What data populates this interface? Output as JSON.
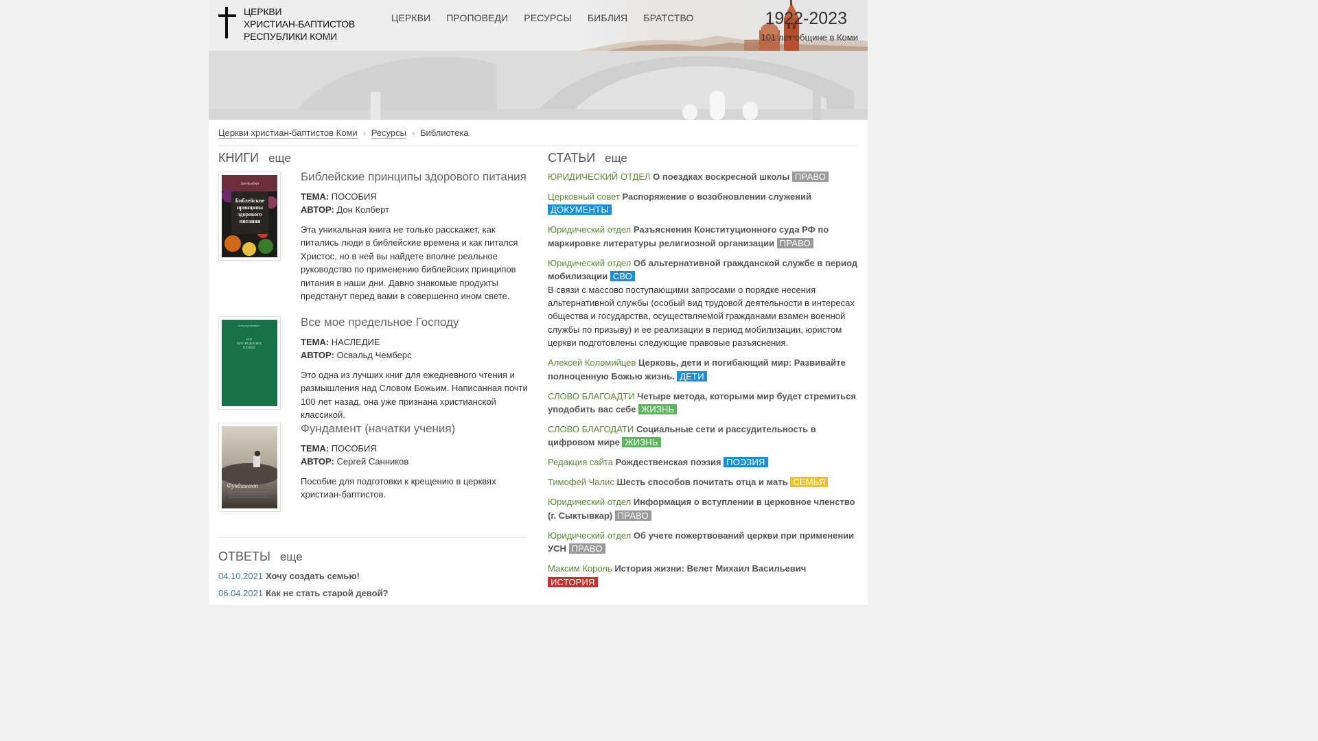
{
  "header": {
    "logo_lines": [
      "ЦЕРКВИ",
      "ХРИСТИАН-БАПТИСТОВ",
      "РЕСПУБЛИКИ КОМИ"
    ],
    "nav": [
      "ЦЕРКВИ",
      "ПРОПОВЕДИ",
      "РЕСУРСЫ",
      "БИБЛИЯ",
      "БРАТСТВО"
    ],
    "years": "1922-2023",
    "years_sub": "101 лет общине в Коми"
  },
  "breadcrumb": [
    "Церкви христиан-баптистов Коми",
    "Ресурсы",
    "Библиотека"
  ],
  "books": {
    "title": "КНИГИ",
    "more": "еще",
    "items": [
      {
        "title": "Библейские принципы здорового питания",
        "topic_label": "ТЕМА:",
        "topic": "ПОСОБИЯ",
        "author_label": "АВТОР:",
        "author": "Дон Колберт",
        "description": "Эта уникальная книга не только расскажет, как питались люди в библейские времена и как питался Христос, но в ней вы найдете вполне реальное руководство по применению библейских принципов питания в наши дни. Давно знакомые продукты предстанут перед вами в совершенно ином свете.",
        "cover_text": "Библейские принципы здорового питания",
        "cover_author": "Дон Колберт"
      },
      {
        "title": "Все мое предельное Господу",
        "topic_label": "ТЕМА:",
        "topic": "НАСЛЕДИЕ",
        "author_label": "АВТОР:",
        "author": "Освальд Чемберс",
        "description": "Это одна из лучших книг для ежедневного чтения и размышления над Словом Божьим. Написанная почти 100 лет назад, она уже признана христианской классикой.",
        "cover_text": "ВСЕ МОЕ ПРЕДЕЛЬНОЕ ГОСПОДУ"
      },
      {
        "title": "Фундамент (начатки учения)",
        "topic_label": "ТЕМА:",
        "topic": "ПОСОБИЯ",
        "author_label": "АВТОР:",
        "author": "Сергей Санников",
        "description": "Пособие для подготовки к крещению в церквях христиан-баптистов.",
        "cover_text": "Фундамент"
      }
    ]
  },
  "answers": {
    "title": "ОТВЕТЫ",
    "more": "еще",
    "items": [
      {
        "date": "04.10.2021",
        "question": "Хочу создать семью!"
      },
      {
        "date": "06.04.2021",
        "question": "Как не стать старой девой?"
      }
    ]
  },
  "articles": {
    "title": "СТАТЬИ",
    "more": "еще",
    "items": [
      {
        "author": "ЮРИДИЧЕСКИЙ ОТДЕЛ",
        "title": "О поездках воскресной школы",
        "tag": "ПРАВО",
        "tag_color": "#9a9a9a"
      },
      {
        "author": "Церковный совет",
        "title": "Распоряжение о возобновлении служений",
        "tag": "ДОКУМЕНТЫ",
        "tag_color": "#1a8fd8"
      },
      {
        "author": "Юридический отдел",
        "title": "Разъяснения Конституционного суда РФ по маркировке литературы религиозной организации",
        "tag": "ПРАВО",
        "tag_color": "#9a9a9a"
      },
      {
        "author": "Юридический отдел",
        "title": "Об альтернативной гражданской службе в период мобилизации",
        "tag": "СВО",
        "tag_color": "#1a8fd8",
        "description": "В связи с массово поступающими запросами о порядке несения альтернативной службы (особый вид трудовой деятельности в интересах общества и государства, осуществляемой гражданами взамен военной службы по призыву)  и ее реализации в период мобилизации, юристом церкви подготовлены следующие правовые разъяснения."
      },
      {
        "author": "Алексей Коломийцев",
        "title": "Церковь, дети и погибающий мир: Развивайте полноценную Божью жизнь.",
        "tag": "ДЕТИ",
        "tag_color": "#1a8fd8"
      },
      {
        "author": "СЛОВО БЛАГОАДТИ",
        "title": "Четыре метода, которыми мир будет стремиться уподобить вас себе",
        "tag": "ЖИЗНЬ",
        "tag_color": "#5cb85c"
      },
      {
        "author": "СЛОВО БЛАГОДАТИ",
        "title": "Социальные сети и рассудительность в цифровом мире",
        "tag": "ЖИЗНЬ",
        "tag_color": "#5cb85c"
      },
      {
        "author": "Редакция сайта",
        "title": "Рождественская поэзия",
        "tag": "ПОЭЗИЯ",
        "tag_color": "#1a8fd8"
      },
      {
        "author": "Тимофей Чалис",
        "title": "Шесть способов почитать отца и мать",
        "tag": "СЕМЬЯ",
        "tag_color": "#f0c419"
      },
      {
        "author": "Юридический отдел",
        "title": "Информация о вступлении в церковное членство (г. Сыктывкар)",
        "tag": "ПРАВО",
        "tag_color": "#9a9a9a"
      },
      {
        "author": "Юридический отдел",
        "title": "Об учете пожертвований церкви при применении УСН",
        "tag": "ПРАВО",
        "tag_color": "#9a9a9a"
      },
      {
        "author": "Максим Король",
        "title": "История жизни: Велет Михаил Васильевич",
        "tag": "ИСТОРИЯ",
        "tag_color": "#c9302c"
      }
    ]
  }
}
